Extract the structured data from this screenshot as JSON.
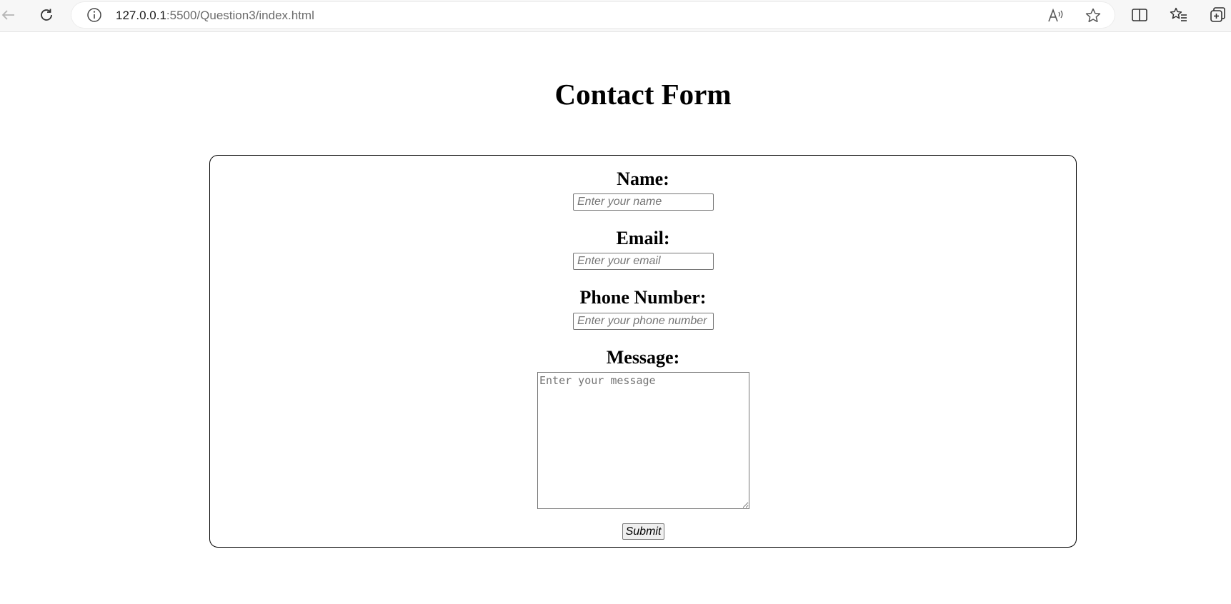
{
  "browser": {
    "url_host": "127.0.0.1",
    "url_path": ":5500/Question3/index.html",
    "icons": [
      "back-arrow-icon",
      "reload-icon",
      "site-info-icon",
      "read-aloud-icon",
      "favorite-star-icon",
      "split-screen-icon",
      "favorites-list-icon",
      "collections-icon"
    ]
  },
  "page": {
    "title": "Contact Form"
  },
  "form": {
    "name_label": "Name:",
    "name_placeholder": "Enter your name",
    "email_label": "Email:",
    "email_placeholder": "Enter your email",
    "phone_label": "Phone Number:",
    "phone_placeholder": "Enter your phone number",
    "message_label": "Message:",
    "message_placeholder": "Enter your message",
    "submit_label": "Submit"
  }
}
